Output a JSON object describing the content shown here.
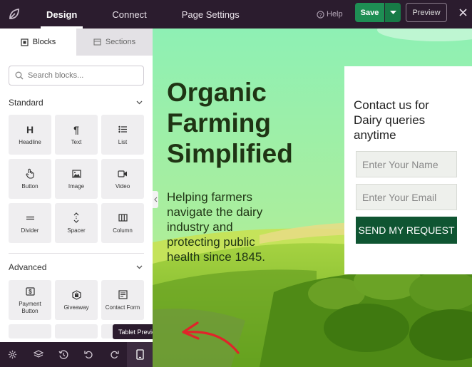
{
  "topbar": {
    "tabs": [
      {
        "label": "Design"
      },
      {
        "label": "Connect"
      },
      {
        "label": "Page Settings"
      }
    ],
    "help_label": "Help",
    "save_label": "Save",
    "preview_label": "Preview"
  },
  "sidebar": {
    "tabs": [
      {
        "label": "Blocks",
        "icon": "blocks-icon"
      },
      {
        "label": "Sections",
        "icon": "sections-icon"
      }
    ],
    "search_placeholder": "Search blocks...",
    "standard": {
      "heading": "Standard",
      "blocks": [
        {
          "label": "Headline",
          "icon": "headline-icon"
        },
        {
          "label": "Text",
          "icon": "text-icon"
        },
        {
          "label": "List",
          "icon": "list-icon"
        },
        {
          "label": "Button",
          "icon": "button-icon"
        },
        {
          "label": "Image",
          "icon": "image-icon"
        },
        {
          "label": "Video",
          "icon": "video-icon"
        },
        {
          "label": "Divider",
          "icon": "divider-icon"
        },
        {
          "label": "Spacer",
          "icon": "spacer-icon"
        },
        {
          "label": "Column",
          "icon": "column-icon"
        }
      ]
    },
    "advanced": {
      "heading": "Advanced",
      "blocks": [
        {
          "label": "Payment Button",
          "icon": "payment-icon"
        },
        {
          "label": "Giveaway",
          "icon": "giveaway-icon"
        },
        {
          "label": "Contact Form",
          "icon": "contact-form-icon"
        }
      ]
    }
  },
  "bottom_toolbar": {
    "tooltip": "Tablet Preview",
    "icons": [
      "settings-icon",
      "layers-icon",
      "history-icon",
      "undo-icon",
      "redo-icon",
      "tablet-icon"
    ]
  },
  "canvas": {
    "hero_title": "Organic Farming Simplified",
    "hero_subtitle": "Helping farmers navigate the dairy industry and protecting public health since 1845.",
    "form": {
      "title": "Contact us for Dairy queries anytime",
      "name_placeholder": "Enter Your Name",
      "email_placeholder": "Enter Your Email",
      "submit_label": "SEND MY REQUEST"
    }
  },
  "colors": {
    "topbar_bg": "#2b1c2e",
    "save_green": "#1e8e54",
    "form_button": "#0f5532",
    "hero_text": "#1f3414",
    "annotation_arrow": "#e0242a"
  }
}
